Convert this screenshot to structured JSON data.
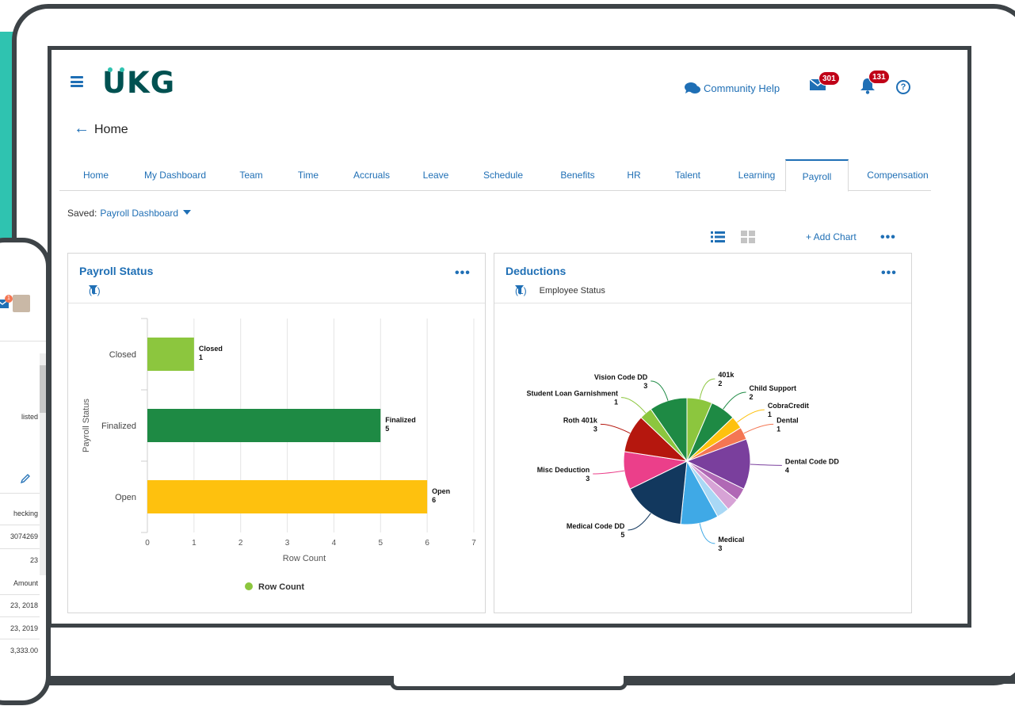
{
  "header": {
    "logo_text": "UKG",
    "community_help": "Community Help",
    "mail_count": "301",
    "notification_count": "131",
    "help_glyph": "?",
    "back_glyph": "←",
    "page_title": "Home"
  },
  "tabs": [
    {
      "label": "Home"
    },
    {
      "label": "My Dashboard"
    },
    {
      "label": "Team"
    },
    {
      "label": "Time"
    },
    {
      "label": "Accruals"
    },
    {
      "label": "Leave"
    },
    {
      "label": "Schedule"
    },
    {
      "label": "Benefits"
    },
    {
      "label": "HR"
    },
    {
      "label": "Talent"
    },
    {
      "label": "Learning"
    },
    {
      "label": "Payroll",
      "active": true
    },
    {
      "label": "Compensation"
    }
  ],
  "toolbar": {
    "saved_label": "Saved:",
    "saved_value": "Payroll Dashboard",
    "add_chart": "+ Add Chart",
    "more": "•••"
  },
  "payroll_card": {
    "title": "Payroll Status",
    "filter_count": "(1)",
    "more": "•••"
  },
  "deductions_card": {
    "title": "Deductions",
    "filter_count": "(1)",
    "filter_label": "Employee Status",
    "more": "•••"
  },
  "chart_data": [
    {
      "type": "bar",
      "orientation": "horizontal",
      "title": "Payroll Status",
      "categories": [
        "Closed",
        "Finalized",
        "Open"
      ],
      "values": [
        1,
        5,
        6
      ],
      "colors": [
        "#8cc63e",
        "#1e8a44",
        "#fec10e"
      ],
      "data_labels": [
        [
          "Closed",
          "1"
        ],
        [
          "Finalized",
          "5"
        ],
        [
          "Open",
          "6"
        ]
      ],
      "xlabel": "Row Count",
      "ylabel": "Payroll Status",
      "xlim": [
        0,
        7
      ],
      "xticks": [
        "0",
        "1",
        "2",
        "3",
        "4",
        "5",
        "6",
        "7"
      ],
      "grid": true,
      "legend": {
        "position": "bottom",
        "entries": [
          "Row Count"
        ],
        "color": "#8cc63e"
      }
    },
    {
      "type": "pie",
      "title": "Deductions",
      "slices": [
        {
          "label": "401k",
          "value": 2,
          "color": "#8cc63e"
        },
        {
          "label": "Child Support",
          "value": 2,
          "color": "#1e8a44"
        },
        {
          "label": "CobraCredit",
          "value": 1,
          "color": "#fec10e"
        },
        {
          "label": "Dental",
          "value": 1,
          "color": "#f47653"
        },
        {
          "label": "Dental Code DD",
          "value": 4,
          "color": "#7a3f9d"
        },
        {
          "label": "",
          "value": 1,
          "color": "#b068b5"
        },
        {
          "label": "",
          "value": 1,
          "color": "#d7a3d6"
        },
        {
          "label": "",
          "value": 1,
          "color": "#a9d8f5"
        },
        {
          "label": "Medical",
          "value": 3,
          "color": "#3fa9e6"
        },
        {
          "label": "Medical Code DD",
          "value": 5,
          "color": "#12385e"
        },
        {
          "label": "Misc Deduction",
          "value": 3,
          "color": "#eb3f8a"
        },
        {
          "label": "Roth 401k",
          "value": 3,
          "color": "#b5170e"
        },
        {
          "label": "Student Loan Garnishment",
          "value": 1,
          "color": "#8cc63e"
        },
        {
          "label": "Vision Code DD",
          "value": 3,
          "color": "#1e8a44"
        }
      ]
    }
  ],
  "phone": {
    "lines": [
      "listed",
      "hecking",
      "3074269",
      "23",
      "Amount",
      "23, 2018",
      "23, 2019",
      "3,333.00"
    ],
    "mail_badge": "1"
  }
}
